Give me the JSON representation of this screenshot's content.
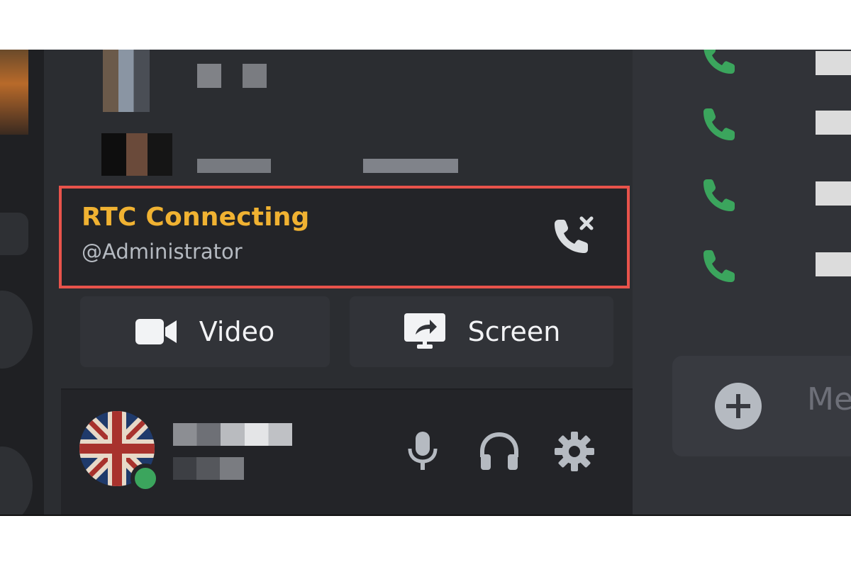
{
  "voice_status": {
    "status_text": "RTC Connecting",
    "channel_text": "@Administrator",
    "disconnect_icon": "phone-disconnect-icon",
    "status_color": "#f0b232",
    "highlight_color": "#e8534b"
  },
  "actions": {
    "video_label": "Video",
    "video_icon": "video-camera-icon",
    "screen_label": "Screen",
    "screen_icon": "screen-share-icon"
  },
  "user_panel": {
    "status": "online",
    "status_color": "#3ba55d",
    "controls": [
      "microphone-icon",
      "headphones-icon",
      "settings-gear-icon"
    ]
  },
  "right_panel": {
    "call_icons": [
      "phone-icon",
      "phone-icon",
      "phone-icon",
      "phone-icon"
    ],
    "call_icon_color": "#3ba55d",
    "message_placeholder": "Me"
  }
}
